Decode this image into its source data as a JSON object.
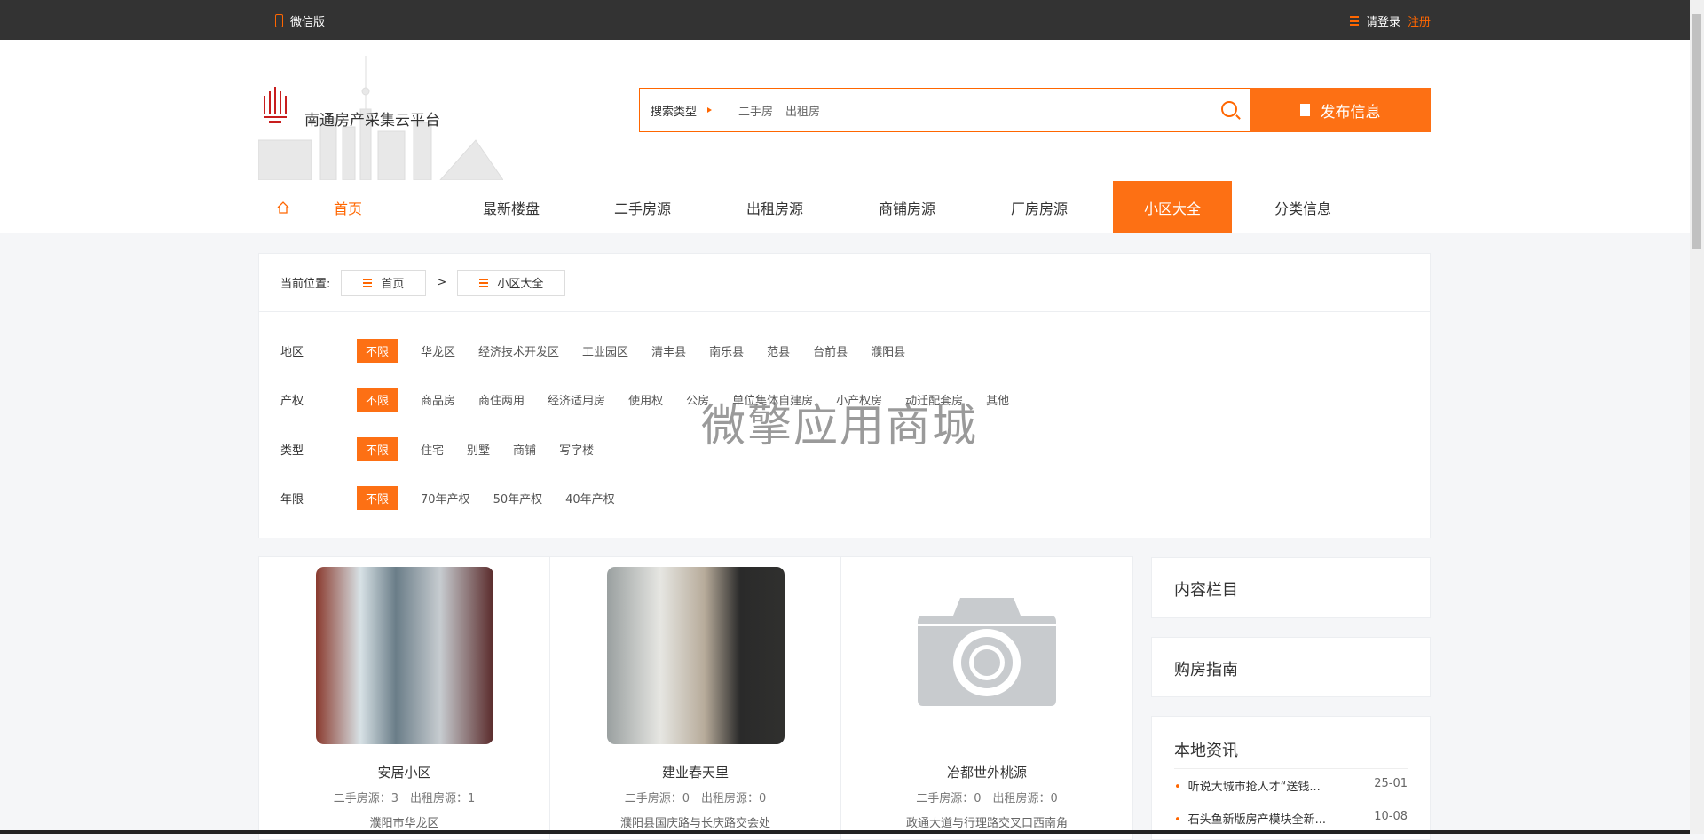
{
  "topbar": {
    "wechat": "微信版",
    "login": "请登录",
    "register": "注册"
  },
  "header": {
    "logo_text": "南通房产采集云平台",
    "search_type": "搜索类型",
    "search_options": [
      "二手房",
      "出租房"
    ],
    "publish": "发布信息"
  },
  "nav": {
    "items": [
      "首页",
      "最新楼盘",
      "二手房源",
      "出租房源",
      "商铺房源",
      "厂房房源",
      "小区大全",
      "分类信息"
    ],
    "active": "小区大全"
  },
  "breadcrumb": {
    "label": "当前位置:",
    "items": [
      "首页",
      "小区大全"
    ],
    "separator": ">"
  },
  "filters": [
    {
      "label": "地区",
      "options": [
        "不限",
        "华龙区",
        "经济技术开发区",
        "工业园区",
        "清丰县",
        "南乐县",
        "范县",
        "台前县",
        "濮阳县"
      ]
    },
    {
      "label": "产权",
      "options": [
        "不限",
        "商品房",
        "商住两用",
        "经济适用房",
        "使用权",
        "公房",
        "单位集体自建房",
        "小产权房",
        "动迁配套房",
        "其他"
      ]
    },
    {
      "label": "类型",
      "options": [
        "不限",
        "住宅",
        "别墅",
        "商铺",
        "写字楼"
      ]
    },
    {
      "label": "年限",
      "options": [
        "不限",
        "70年产权",
        "50年产权",
        "40年产权"
      ]
    }
  ],
  "watermark": "微擎应用商城",
  "communities": [
    {
      "name": "安居小区",
      "stats": "二手房源：3　出租房源：1",
      "address": "濮阳市华龙区"
    },
    {
      "name": "建业春天里",
      "stats": "二手房源：0　出租房源：0",
      "address": "濮阳县国庆路与长庆路交会处"
    },
    {
      "name": "冶都世外桃源",
      "stats": "二手房源：0　出租房源：0",
      "address": "政通大道与行理路交叉口西南角"
    }
  ],
  "sidebar": {
    "content": "内容栏目",
    "guide": "购房指南",
    "news_title": "本地资讯",
    "news": [
      {
        "title": "听说大城市抢人才“送钱...",
        "date": "25-01"
      },
      {
        "title": "石头鱼新版房产模块全新...",
        "date": "10-08"
      }
    ]
  },
  "colors": {
    "accent": "#fd7014",
    "topbar": "#333333"
  }
}
